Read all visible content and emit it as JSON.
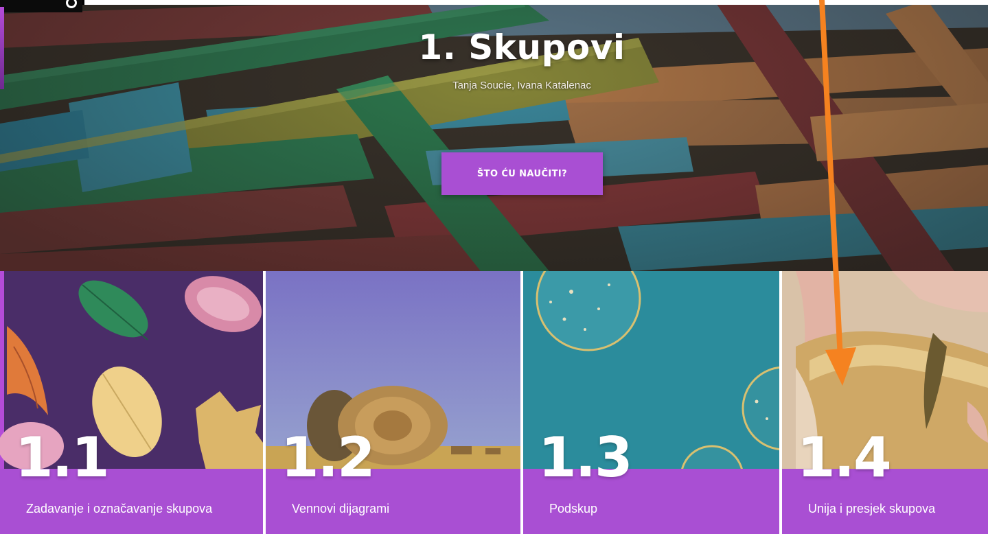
{
  "hero": {
    "title": "1. Skupovi",
    "authors": "Tanja Soucie, Ivana Katalenac",
    "cta_label": "ŠTO ĆU NAUČITI?"
  },
  "colors": {
    "accent_purple": "#a94fd3",
    "annotation_orange": "#f58220"
  },
  "annotation": {
    "icon": "arrow-down-icon"
  },
  "cards": [
    {
      "number": "1.1",
      "label": "Zadavanje i označavanje skupova",
      "image": "autumn-leaves-icon"
    },
    {
      "number": "1.2",
      "label": "Vennovi dijagrami",
      "image": "hay-bale-icon"
    },
    {
      "number": "1.3",
      "label": "Podskup",
      "image": "bubbles-icon"
    },
    {
      "number": "1.4",
      "label": "Unija i presjek skupova",
      "image": "broken-bread-icon"
    }
  ]
}
